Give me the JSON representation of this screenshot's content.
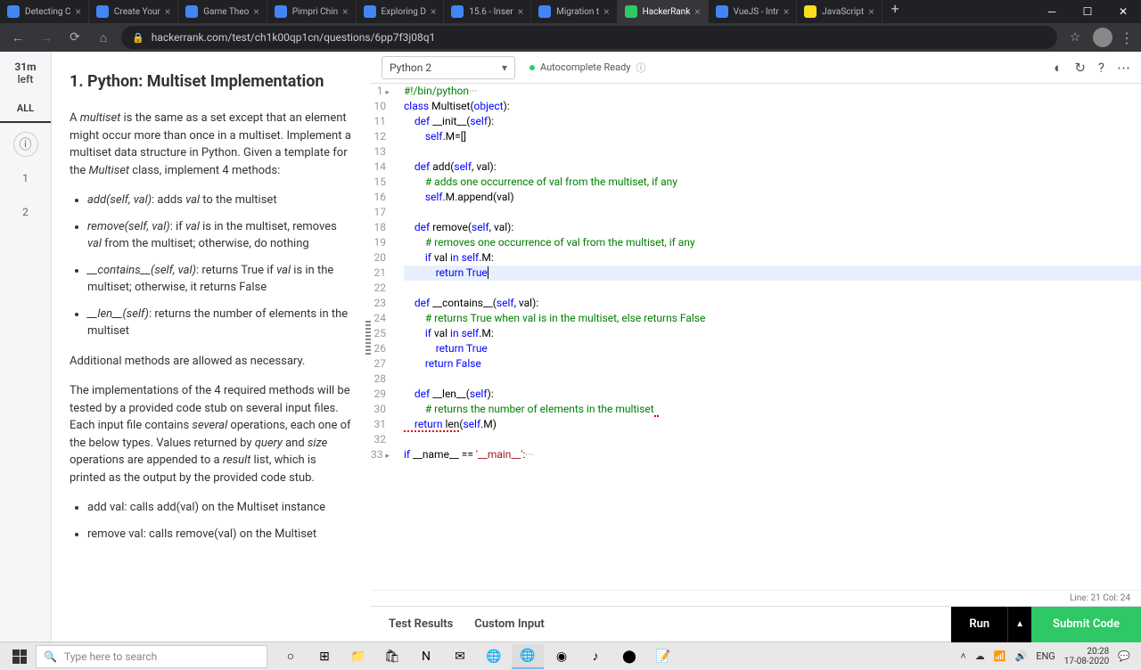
{
  "tabs": [
    {
      "title": "Detecting C"
    },
    {
      "title": "Create Your"
    },
    {
      "title": "Game Theo"
    },
    {
      "title": "Pimpri Chin"
    },
    {
      "title": "Exploring D"
    },
    {
      "title": "15.6 - Inser"
    },
    {
      "title": "Migration t"
    },
    {
      "title": "HackerRank",
      "active": true
    },
    {
      "title": "VueJS - Intr"
    },
    {
      "title": "JavaScript"
    }
  ],
  "url": "hackerrank.com/test/ch1k00qp1cn/questions/6pp7f3j08q1",
  "timer": {
    "time": "31m",
    "label": "left"
  },
  "sidenav": {
    "all": "ALL",
    "q1": "1",
    "q2": "2"
  },
  "problem": {
    "title": "1. Python: Multiset Implementation",
    "p1a": "A ",
    "p1b": "multiset",
    "p1c": " is the same as a set except that an element might occur more than once in a multiset. Implement a multiset data structure in Python. Given a template for the ",
    "p1d": "Multiset",
    "p1e": " class, implement 4 methods:",
    "li1a": "add(self, val)",
    "li1b": ": adds ",
    "li1c": "val",
    "li1d": " to the multiset",
    "li2a": "remove(self, val)",
    "li2b": ": if ",
    "li2c": "val",
    "li2d": " is in the multiset, removes ",
    "li2e": "val",
    "li2f": " from the multiset; otherwise, do nothing",
    "li3a": "__contains__(self, val)",
    "li3b": ": returns True if ",
    "li3c": "val",
    "li3d": " is in the multiset; otherwise, it returns False",
    "li4a": "__len__(self)",
    "li4b": ": returns the number of elements in the multiset",
    "p2": "Additional methods are allowed as necessary.",
    "p3a": "The implementations of the 4 required methods will be tested by a provided code stub on several input files. Each input file contains ",
    "p3b": "several",
    "p3c": " operations, each one of the below types. Values returned by ",
    "p3d": "query",
    "p3e": " and ",
    "p3f": "size",
    "p3g": " operations are appended to a ",
    "p3h": "result",
    "p3i": " list, which is printed as the output by the provided code stub.",
    "li5": "add val: calls add(val) on the Multiset instance",
    "li6": "remove val: calls remove(val) on the Multiset"
  },
  "editor": {
    "language": "Python 2",
    "autocomplete": "Autocomplete Ready",
    "lines": {
      "1": "#!/bin/python",
      "10": "class Multiset(object):",
      "11": "    def __init__(self):",
      "12": "        self.M=[]",
      "13": "",
      "14": "    def add(self, val):",
      "15": "        # adds one occurrence of val from the multiset, if any",
      "16": "        self.M.append(val)",
      "17": "",
      "18": "    def remove(self, val):",
      "19": "        # removes one occurrence of val from the multiset, if any",
      "20": "        if val in self.M:",
      "21": "            return True",
      "22": "",
      "23": "    def __contains__(self, val):",
      "24": "        # returns True when val is in the multiset, else returns False",
      "25": "        if val in self.M:",
      "26": "            return True",
      "27": "        return False",
      "28": "",
      "29": "    def __len__(self):",
      "30": "        # returns the number of elements in the multiset",
      "31": "    return len(self.M)",
      "32": "",
      "33": "if __name__ == '__main__':"
    },
    "status": "Line: 21 Col: 24"
  },
  "bottom": {
    "test_results": "Test Results",
    "custom_input": "Custom Input",
    "run": "Run",
    "submit": "Submit Code"
  },
  "taskbar": {
    "search_placeholder": "Type here to search",
    "lang": "ENG",
    "time": "20:28",
    "date": "17-08-2020"
  }
}
